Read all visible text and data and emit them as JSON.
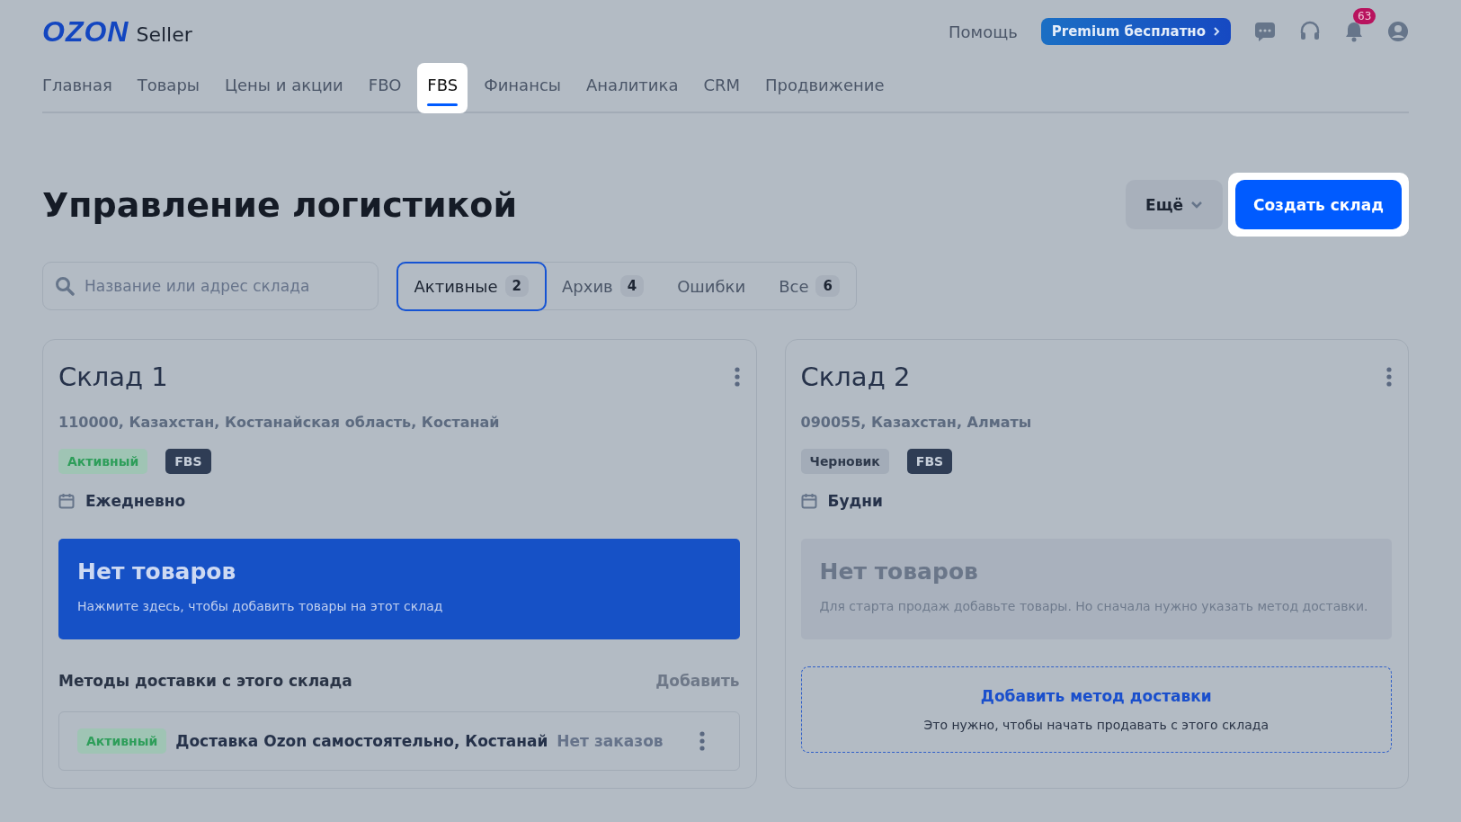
{
  "header": {
    "logo": "OZON",
    "logo_suffix": "Seller",
    "help": "Помощь",
    "premium": "Premium бесплатно",
    "notifications": "63"
  },
  "nav": [
    {
      "label": "Главная",
      "selected": false
    },
    {
      "label": "Товары",
      "selected": false
    },
    {
      "label": "Цены и акции",
      "selected": false
    },
    {
      "label": "FBO",
      "selected": false
    },
    {
      "label": "FBS",
      "selected": true
    },
    {
      "label": "Финансы",
      "selected": false
    },
    {
      "label": "Аналитика",
      "selected": false
    },
    {
      "label": "CRM",
      "selected": false
    },
    {
      "label": "Продвижение",
      "selected": false
    }
  ],
  "page": {
    "title": "Управление логистикой",
    "more_button": "Ещё",
    "create_button": {
      "label": "Создать склад",
      "spotlight": true
    }
  },
  "search": {
    "placeholder": "Название или адрес склада"
  },
  "filters": [
    {
      "label": "Активные",
      "count": "2",
      "selected": true
    },
    {
      "label": "Архив",
      "count": "4",
      "selected": false
    },
    {
      "label": "Ошибки",
      "selected": false
    },
    {
      "label": "Все",
      "count": "6",
      "selected": false
    }
  ],
  "warehouses": [
    {
      "name": "Склад 1",
      "address": "110000, Казахстан, Костанайская область, Костанай",
      "status": {
        "label": "Активный",
        "kind": "active"
      },
      "type": "FBS",
      "schedule": "Ежедневно",
      "products": {
        "kind": "action",
        "title": "Нет товаров",
        "text": "Нажмите здесь, чтобы добавить товары на этот склад"
      },
      "delivery": {
        "kind": "list",
        "title": "Методы доставки с этого склада",
        "add": "Добавить",
        "methods": [
          {
            "status": {
              "label": "Активный",
              "kind": "active"
            },
            "name": "Доставка Ozon самостоятельно, Костанай",
            "orders": "Нет заказов"
          }
        ]
      }
    },
    {
      "name": "Склад 2",
      "address": "090055, Казахстан, Алматы",
      "status": {
        "label": "Черновик",
        "kind": "draft"
      },
      "type": "FBS",
      "schedule": "Будни",
      "products": {
        "kind": "muted",
        "title": "Нет товаров",
        "text": "Для старта продаж добавьте товары. Но сначала нужно указать метод доставки."
      },
      "delivery": {
        "kind": "prompt",
        "title": "Добавить метод доставки",
        "text": "Это нужно, чтобы начать продавать с этого склада"
      }
    }
  ]
}
